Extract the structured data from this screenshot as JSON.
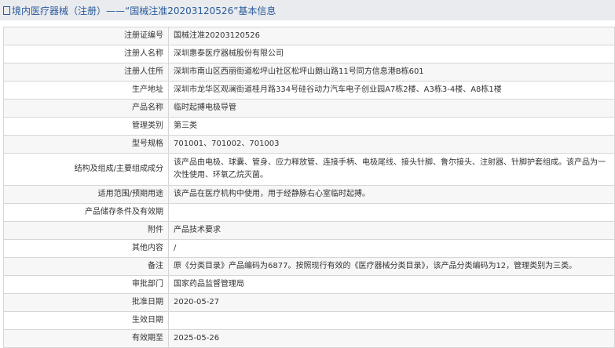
{
  "header": {
    "title": "境内医疗器械（注册）——“国械注准20203120526”基本信息"
  },
  "rows": [
    {
      "label": "注册证编号",
      "value": "国械注准20203120526"
    },
    {
      "label": "注册人名称",
      "value": "深圳惠泰医疗器械股份有限公司"
    },
    {
      "label": "注册人住所",
      "value": "深圳市南山区西丽街道松坪山社区松坪山朗山路11号同方信息港B栋601"
    },
    {
      "label": "生产地址",
      "value": "深圳市龙华区观澜街道桂月路334号硅谷动力汽车电子创业园A7栋2楼、A3栋3-4楼、A8栋1楼"
    },
    {
      "label": "产品名称",
      "value": "临时起搏电极导管"
    },
    {
      "label": "管理类别",
      "value": "第三类"
    },
    {
      "label": "型号规格",
      "value": "701001、701002、701003"
    },
    {
      "label": "结构及组成/主要组成成分",
      "value": "该产品由电极、球囊、管身、应力释放管、连接手柄、电极尾线、接头针脚、鲁尔接头、注射器、针脚护套组成。该产品为一次性使用、环氧乙烷灭菌。"
    },
    {
      "label": "适用范围/预期用途",
      "value": "该产品在医疗机构中使用，用于经静脉右心室临时起搏。"
    },
    {
      "label": "产品储存条件及有效期",
      "value": ""
    },
    {
      "label": "附件",
      "value": "产品技术要求"
    },
    {
      "label": "其他内容",
      "value": "/"
    },
    {
      "label": "备注",
      "value": "原《分类目录》产品编码为6877。按照现行有效的《医疗器械分类目录》，该产品分类编码为12，管理类别为三类。"
    },
    {
      "label": "审批部门",
      "value": "国家药品监督管理局"
    },
    {
      "label": "批准日期",
      "value": "2020-05-27"
    },
    {
      "label": "生效日期",
      "value": ""
    },
    {
      "label": "有效期至",
      "value": "2025-05-26"
    }
  ]
}
